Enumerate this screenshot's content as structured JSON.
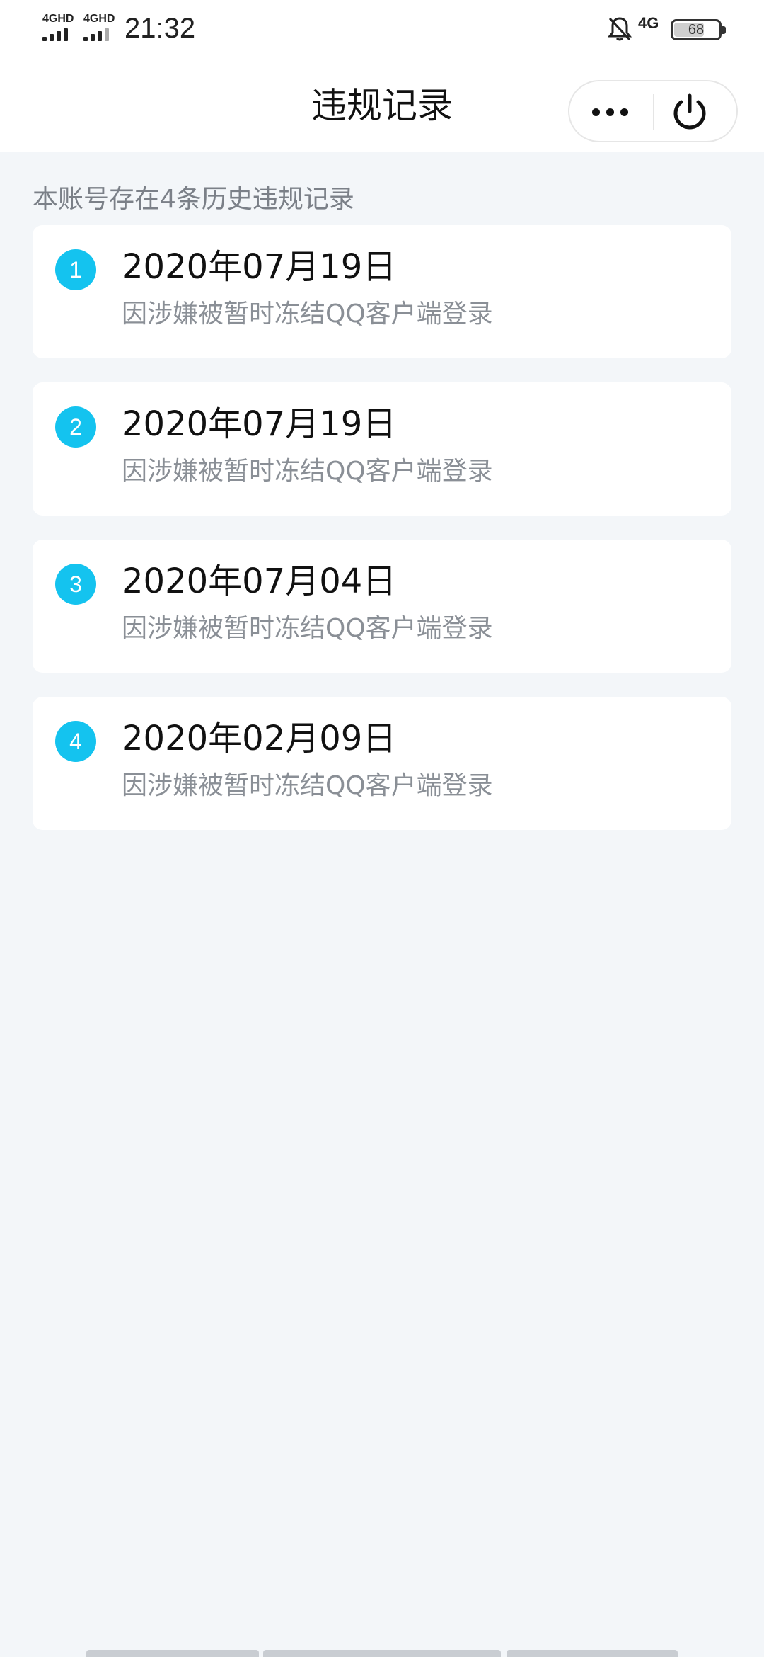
{
  "status_bar": {
    "signal1": "4GHD",
    "signal2": "4GHD",
    "time": "21:32",
    "network": "4G",
    "battery": "68",
    "battery_level": 0.68
  },
  "nav": {
    "title": "违规记录"
  },
  "summary": "本账号存在4条历史违规记录",
  "records": [
    {
      "index": "1",
      "date": "2020年07月19日",
      "desc": "因涉嫌被暂时冻结QQ客户端登录"
    },
    {
      "index": "2",
      "date": "2020年07月19日",
      "desc": "因涉嫌被暂时冻结QQ客户端登录"
    },
    {
      "index": "3",
      "date": "2020年07月04日",
      "desc": "因涉嫌被暂时冻结QQ客户端登录"
    },
    {
      "index": "4",
      "date": "2020年02月09日",
      "desc": "因涉嫌被暂时冻结QQ客户端登录"
    }
  ],
  "icons": {
    "bell": "bell-muted-icon",
    "more": "more-dots-icon",
    "power": "power-icon"
  },
  "colors": {
    "badge": "#14c3ef",
    "background": "#f3f6f9",
    "card": "#ffffff",
    "secondary_text": "#8a8f96"
  }
}
